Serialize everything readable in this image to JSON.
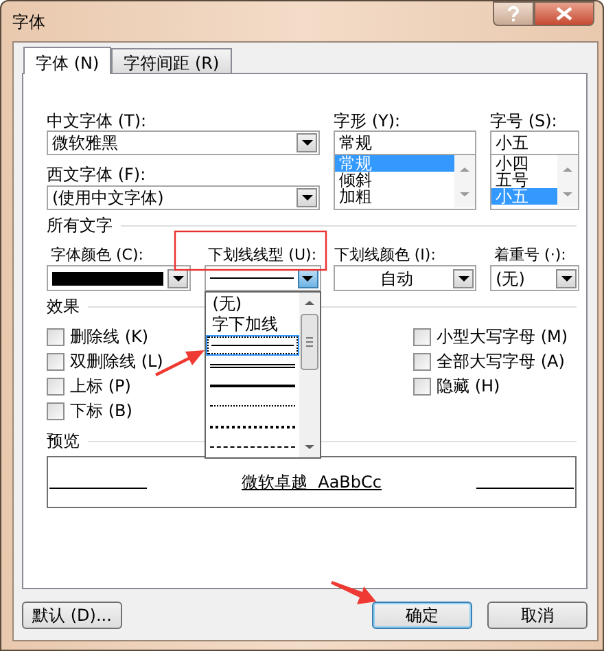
{
  "window": {
    "title": "字体"
  },
  "tabs": [
    {
      "label": "字体 (N)",
      "selected": true
    },
    {
      "label": "字符间距 (R)",
      "selected": false
    }
  ],
  "font": {
    "chinese_font": {
      "label": "中文字体 (T):",
      "value": "微软雅黑"
    },
    "western_font": {
      "label": "西文字体 (F):",
      "value": "(使用中文字体)"
    },
    "style": {
      "label": "字形 (Y):",
      "value": "常规",
      "options": [
        {
          "label": "常规",
          "selected": true
        },
        {
          "label": "倾斜",
          "selected": false
        },
        {
          "label": "加粗",
          "selected": false
        }
      ]
    },
    "size": {
      "label": "字号 (S):",
      "value": "小五",
      "options": [
        {
          "label": "小四",
          "selected": false
        },
        {
          "label": "五号",
          "selected": false
        },
        {
          "label": "小五",
          "selected": true
        }
      ]
    }
  },
  "all_text": {
    "title": "所有文字",
    "font_color": {
      "label": "字体颜色 (C):",
      "color": "#000000"
    },
    "underline_style": {
      "label": "下划线线型 (U):",
      "open": true,
      "options": [
        {
          "kind": "text",
          "label": "(无)",
          "selected": false
        },
        {
          "kind": "text",
          "label": "字下加线",
          "selected": false
        },
        {
          "kind": "line",
          "selected": true
        },
        {
          "kind": "line",
          "selected": false
        },
        {
          "kind": "line",
          "selected": false
        },
        {
          "kind": "line",
          "selected": false
        },
        {
          "kind": "line",
          "selected": false
        },
        {
          "kind": "line",
          "selected": false
        }
      ]
    },
    "underline_color": {
      "label": "下划线颜色 (I):",
      "value": "自动"
    },
    "emphasis": {
      "label": "着重号 (·):",
      "value": "(无)"
    }
  },
  "effects": {
    "title": "效果",
    "columns": [
      [
        {
          "label": "删除线 (K)",
          "checked": false
        },
        {
          "label": "双删除线 (L)",
          "checked": false
        },
        {
          "label": "上标 (P)",
          "checked": false
        },
        {
          "label": "下标 (B)",
          "checked": false
        }
      ],
      [
        {
          "label": "小型大写字母 (M)",
          "checked": false
        },
        {
          "label": "全部大写字母 (A)",
          "checked": false
        },
        {
          "label": "隐藏 (H)",
          "checked": false
        }
      ]
    ]
  },
  "preview": {
    "title": "预览",
    "sample": "微软卓越  AaBbCc"
  },
  "buttons": [
    {
      "label": "默认 (D)...",
      "focused": false
    },
    {
      "label": "确定",
      "focused": true
    },
    {
      "label": "取消",
      "focused": false
    }
  ]
}
